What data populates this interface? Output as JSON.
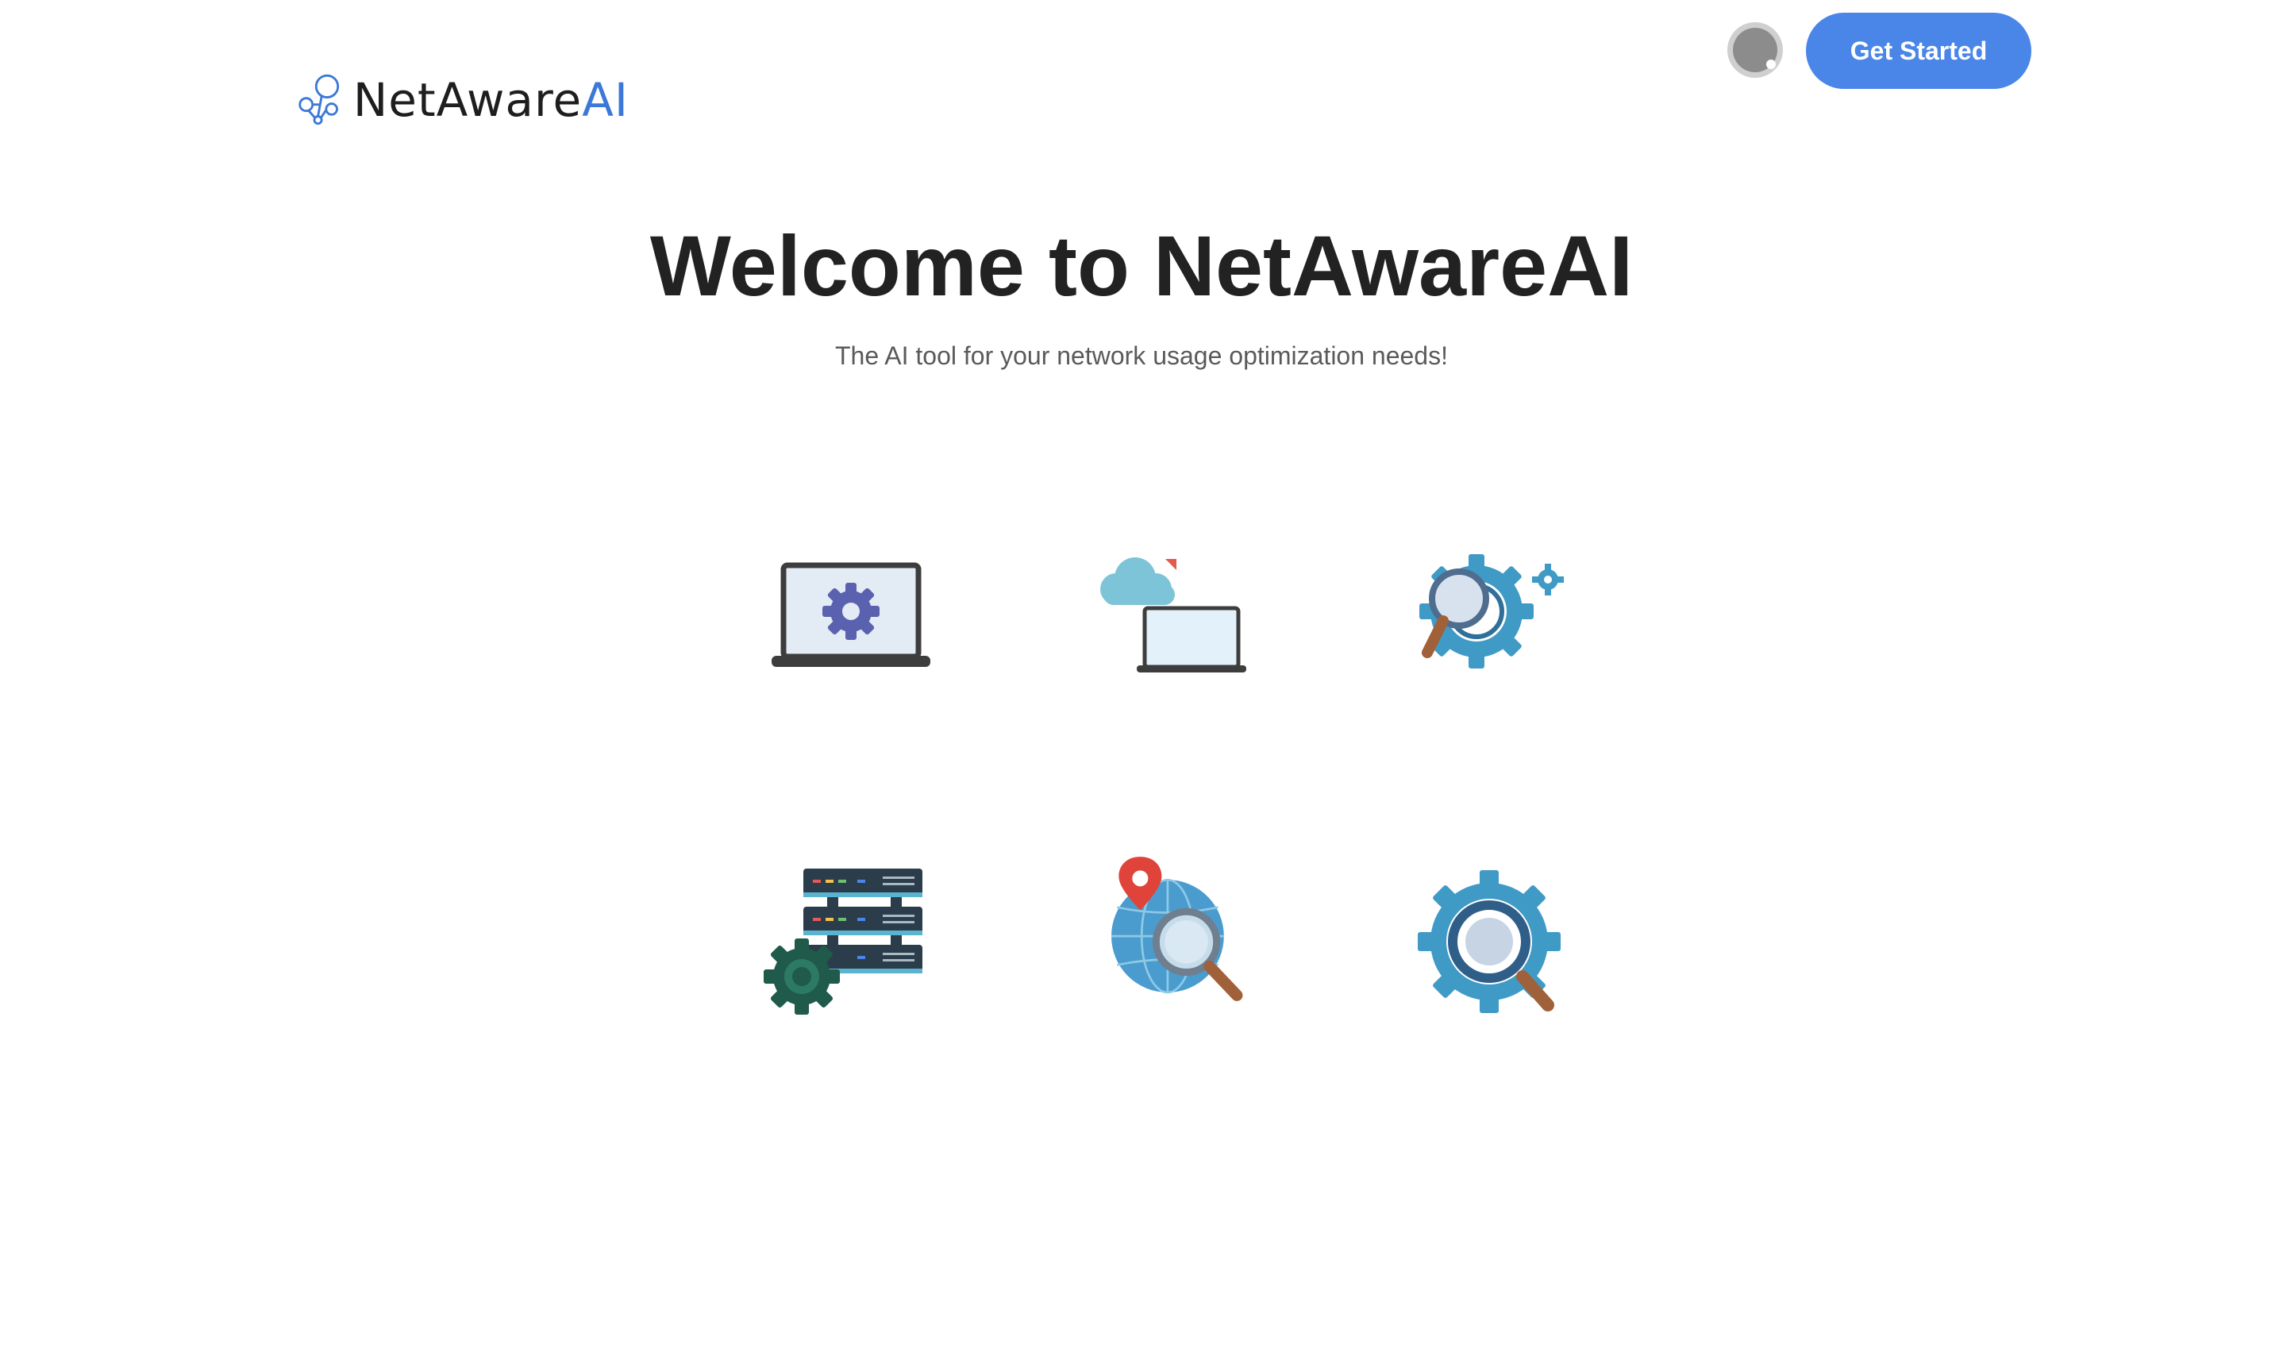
{
  "header": {
    "logo": {
      "name_dark": "NetAware",
      "name_accent": "AI",
      "icon": "network-nodes-icon"
    },
    "avatar": {
      "icon": "user-avatar-icon"
    },
    "cta_label": "Get Started"
  },
  "hero": {
    "title": "Welcome to NetAwareAI",
    "subtitle": "The AI tool for your network usage optimization needs!"
  },
  "features": [
    {
      "icon": "laptop-settings-icon"
    },
    {
      "icon": "cloud-laptop-icon"
    },
    {
      "icon": "gear-magnifier-icon"
    },
    {
      "icon": "server-gear-icon"
    },
    {
      "icon": "globe-location-search-icon"
    },
    {
      "icon": "gear-search-icon"
    }
  ],
  "colors": {
    "primary": "#4a86e8",
    "title": "#222222",
    "subtitle": "#5a5a5a",
    "logo_accent": "#3c78d8"
  }
}
